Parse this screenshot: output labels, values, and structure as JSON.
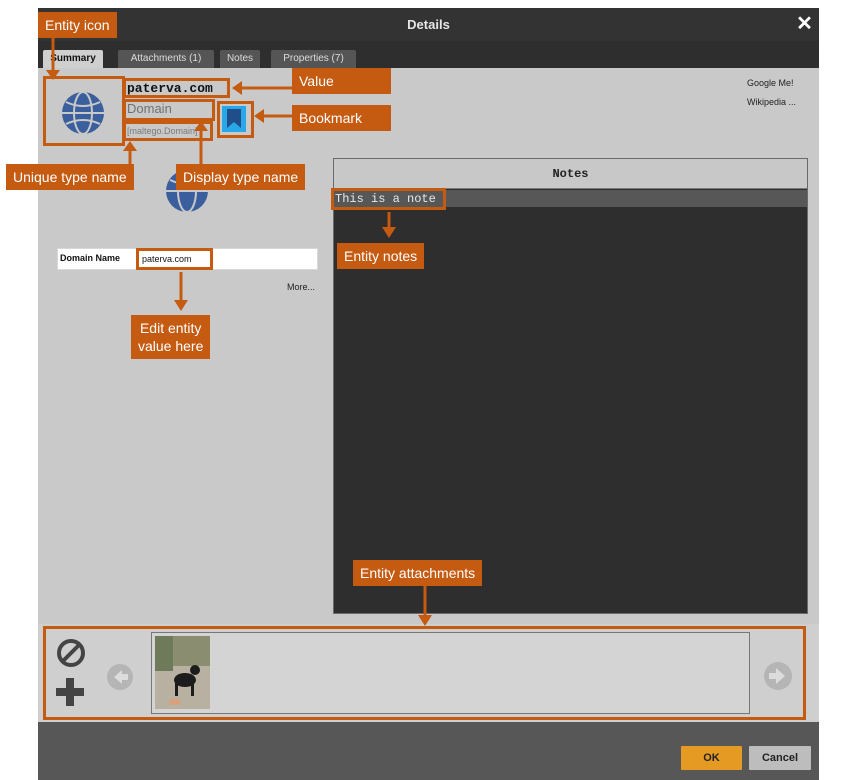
{
  "dialog": {
    "title": "Details",
    "close_symbol": "✕"
  },
  "tabs": [
    {
      "label": "Summary",
      "active": true
    },
    {
      "label": "Attachments (1)",
      "active": false
    },
    {
      "label": "Notes",
      "active": false
    },
    {
      "label": "Properties (7)",
      "active": false
    }
  ],
  "entity": {
    "icon": "globe-icon",
    "value": "paterva.com",
    "display_type_name": "Domain",
    "unique_type_name": "[maltego.Domain]",
    "bookmark_icon": "bookmark-icon"
  },
  "links": {
    "google": "Google Me!",
    "wikipedia": "Wikipedia ..."
  },
  "notes": {
    "header": "Notes",
    "text": "This is a note"
  },
  "property": {
    "label": "Domain Name",
    "value": "paterva.com",
    "more_label": "More..."
  },
  "attachments": {
    "remove_icon": "remove-icon",
    "add_icon": "plus-icon",
    "prev_icon": "arrow-left-icon",
    "next_icon": "arrow-right-icon",
    "items": [
      {
        "type": "image",
        "subject": "dog photo"
      }
    ]
  },
  "buttons": {
    "ok": "OK",
    "cancel": "Cancel"
  },
  "annotations": {
    "entity_icon": "Entity icon",
    "value": "Value",
    "bookmark": "Bookmark",
    "unique_type_name": "Unique type name",
    "display_type_name": "Display type name",
    "entity_notes": "Entity notes",
    "edit_value_line1": "Edit entity",
    "edit_value_line2": "value here",
    "entity_attachments": "Entity attachments"
  },
  "colors": {
    "annotation": "#c55a11",
    "ok_button": "#e59b23",
    "bookmark": "#1f98d8",
    "globe": "#3a5f9c",
    "notes_background": "#2e2e2e"
  }
}
